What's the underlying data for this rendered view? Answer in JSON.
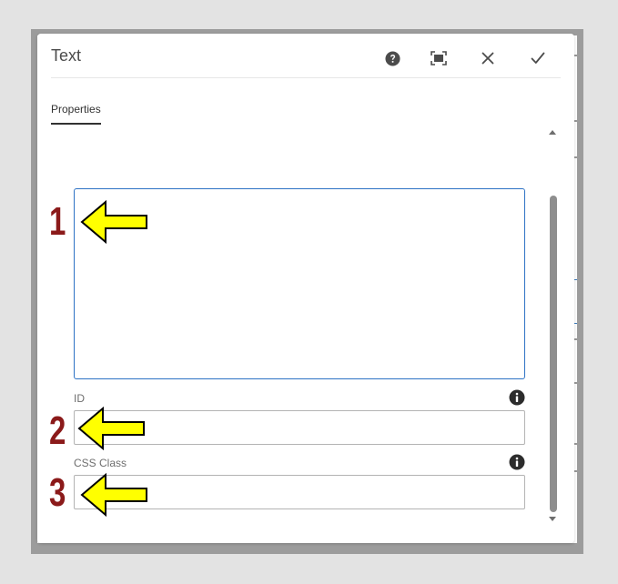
{
  "dialog": {
    "title": "Text",
    "header_buttons": [
      {
        "name": "help",
        "icon": "help-circle-icon"
      },
      {
        "name": "fullscreen",
        "icon": "fullscreen-icon"
      },
      {
        "name": "close",
        "icon": "close-icon"
      },
      {
        "name": "done",
        "icon": "checkmark-icon"
      }
    ],
    "tabs": [
      {
        "label": "Properties",
        "active": true
      }
    ]
  },
  "form": {
    "text_editor": {
      "value": ""
    },
    "id_field": {
      "label": "ID",
      "value": "",
      "info_icon": "info-icon"
    },
    "css_class_field": {
      "label": "CSS Class",
      "value": "",
      "info_icon": "info-icon"
    }
  },
  "annotations": [
    {
      "number": "1",
      "arrow_color": "#ffff00",
      "number_color": "#8b1a1a"
    },
    {
      "number": "2",
      "arrow_color": "#ffff00",
      "number_color": "#8b1a1a"
    },
    {
      "number": "3",
      "arrow_color": "#ffff00",
      "number_color": "#8b1a1a"
    }
  ],
  "colors": {
    "focus_border": "#2d72c4",
    "scrollbar_thumb": "#8e8e8e",
    "frame": "#9c9c9c"
  }
}
